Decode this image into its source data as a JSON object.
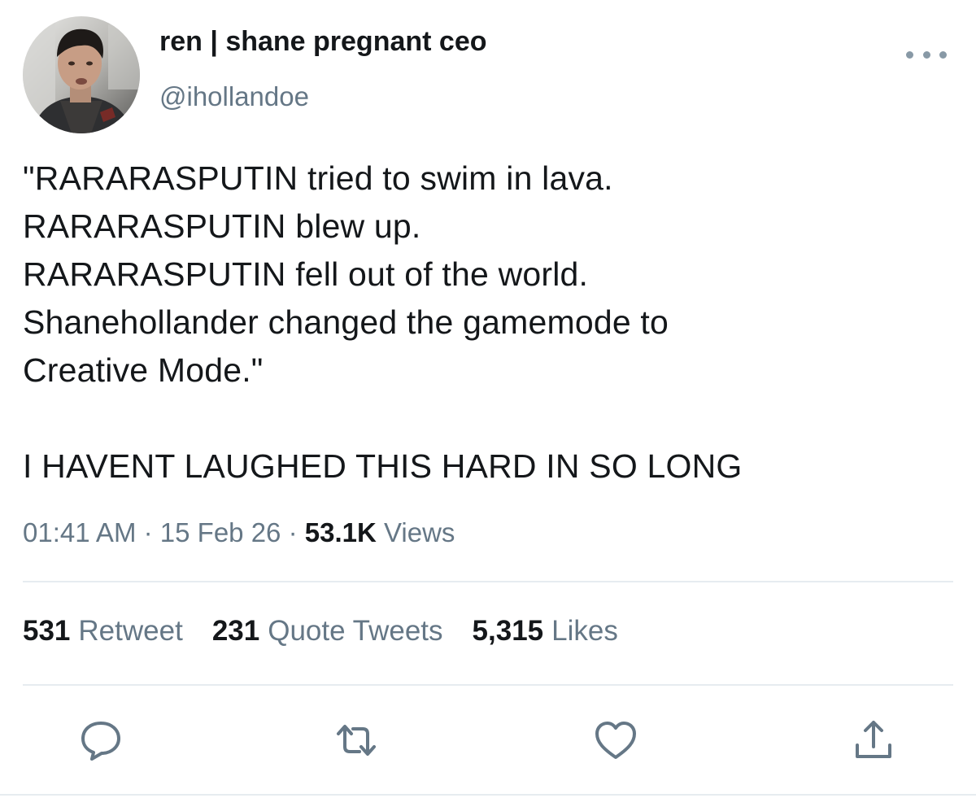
{
  "user": {
    "display_name": "ren | shane pregnant ceo",
    "handle": "@ihollandoe"
  },
  "tweet": {
    "lines": [
      "\"RARARASPUTIN tried to swim in lava.",
      "RARARASPUTIN blew up.",
      "RARARASPUTIN fell out of the world.",
      "Shanehollander changed the gamemode to",
      "Creative Mode.\"",
      "I HAVENT LAUGHED THIS HARD IN SO LONG"
    ]
  },
  "meta": {
    "time": "01:41 AM",
    "separator": "·",
    "date": "15 Feb 26",
    "views_count": "53.1K",
    "views_label": "Views"
  },
  "stats": {
    "retweets_count": "531",
    "retweets_label": "Retweet",
    "quotes_count": "231",
    "quotes_label": "Quote Tweets",
    "likes_count": "5,315",
    "likes_label": "Likes"
  },
  "icons": {
    "reply": "reply-icon",
    "retweet": "retweet-icon",
    "like": "heart-icon",
    "share": "share-icon",
    "more": "more-icon"
  },
  "colors": {
    "text": "#14171a",
    "secondary": "#657786",
    "icon": "#657786",
    "divider": "#e6ecf0"
  }
}
